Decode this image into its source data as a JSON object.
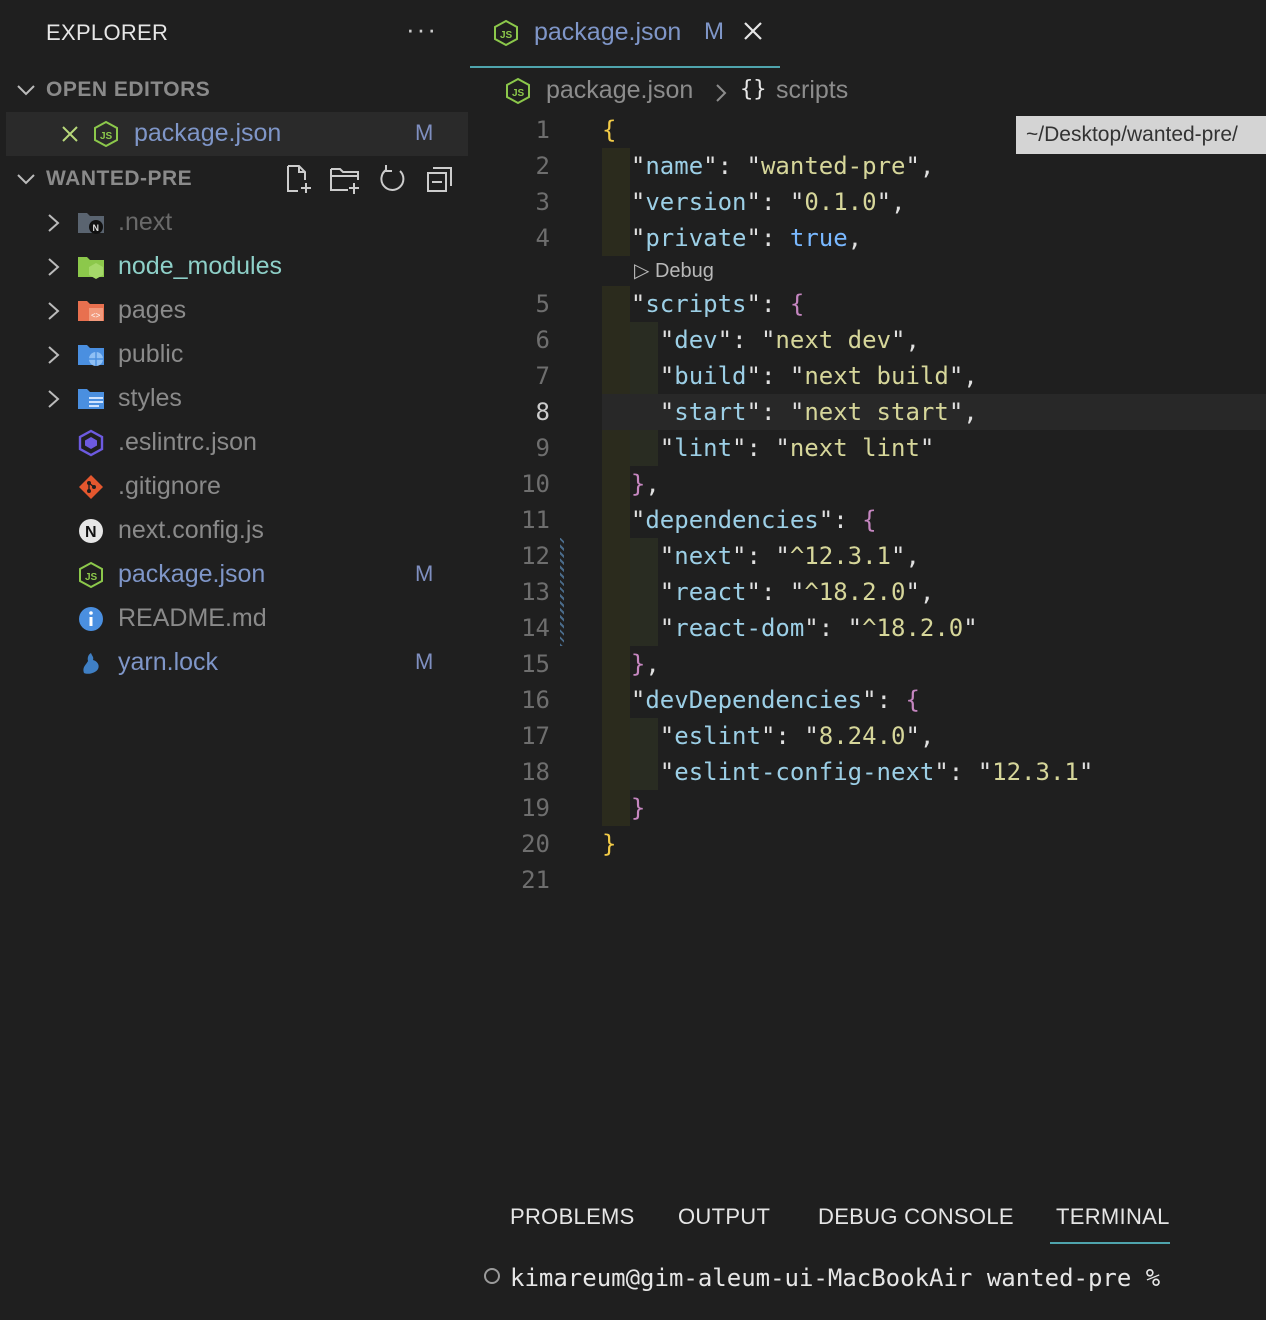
{
  "sidebar": {
    "title": "EXPLORER",
    "more": "···",
    "open_editors_label": "OPEN EDITORS",
    "open_editor": {
      "name": "package.json",
      "badge": "M"
    },
    "project_label": "WANTED-PRE",
    "items": [
      {
        "name": ".next",
        "type": "folder",
        "color": "#6a6a6a",
        "icon": "next-folder-icon"
      },
      {
        "name": "node_modules",
        "type": "folder",
        "color": "#8ed0c8",
        "icon": "node-folder-icon"
      },
      {
        "name": "pages",
        "type": "folder",
        "color": "#8a8a8a",
        "icon": "pages-folder-icon"
      },
      {
        "name": "public",
        "type": "folder",
        "color": "#8a8a8a",
        "icon": "public-folder-icon"
      },
      {
        "name": "styles",
        "type": "folder",
        "color": "#8a8a8a",
        "icon": "styles-folder-icon"
      },
      {
        "name": ".eslintrc.json",
        "type": "file",
        "color": "#8a8a8a",
        "icon": "eslint-icon"
      },
      {
        "name": ".gitignore",
        "type": "file",
        "color": "#8a8a8a",
        "icon": "git-icon"
      },
      {
        "name": "next.config.js",
        "type": "file",
        "color": "#8a8a8a",
        "icon": "next-icon"
      },
      {
        "name": "package.json",
        "type": "file",
        "color": "#7f96c8",
        "icon": "nodejs-icon",
        "badge": "M"
      },
      {
        "name": "README.md",
        "type": "file",
        "color": "#8a8a8a",
        "icon": "info-icon"
      },
      {
        "name": "yarn.lock",
        "type": "file",
        "color": "#7f96c8",
        "icon": "yarn-icon",
        "badge": "M"
      }
    ]
  },
  "editor": {
    "tab": {
      "name": "package.json",
      "badge": "M"
    },
    "breadcrumb": {
      "file": "package.json",
      "symbol_glyph": "{}",
      "symbol": "scripts"
    },
    "tooltip": "~/Desktop/wanted-pre/",
    "codelens": "Debug",
    "lines": [
      "1",
      "2",
      "3",
      "4",
      "5",
      "6",
      "7",
      "8",
      "9",
      "10",
      "11",
      "12",
      "13",
      "14",
      "15",
      "16",
      "17",
      "18",
      "19",
      "20",
      "21"
    ]
  },
  "panel": {
    "tabs": [
      "PROBLEMS",
      "OUTPUT",
      "DEBUG CONSOLE",
      "TERMINAL"
    ],
    "active_tab": "TERMINAL",
    "terminal_prompt": "kimareum@gim-aleum-ui-MacBookAir wanted-pre %"
  },
  "colors": {
    "accent": "#4fa4ad",
    "modified": "#7f96c8",
    "background": "#1f1f1f"
  }
}
